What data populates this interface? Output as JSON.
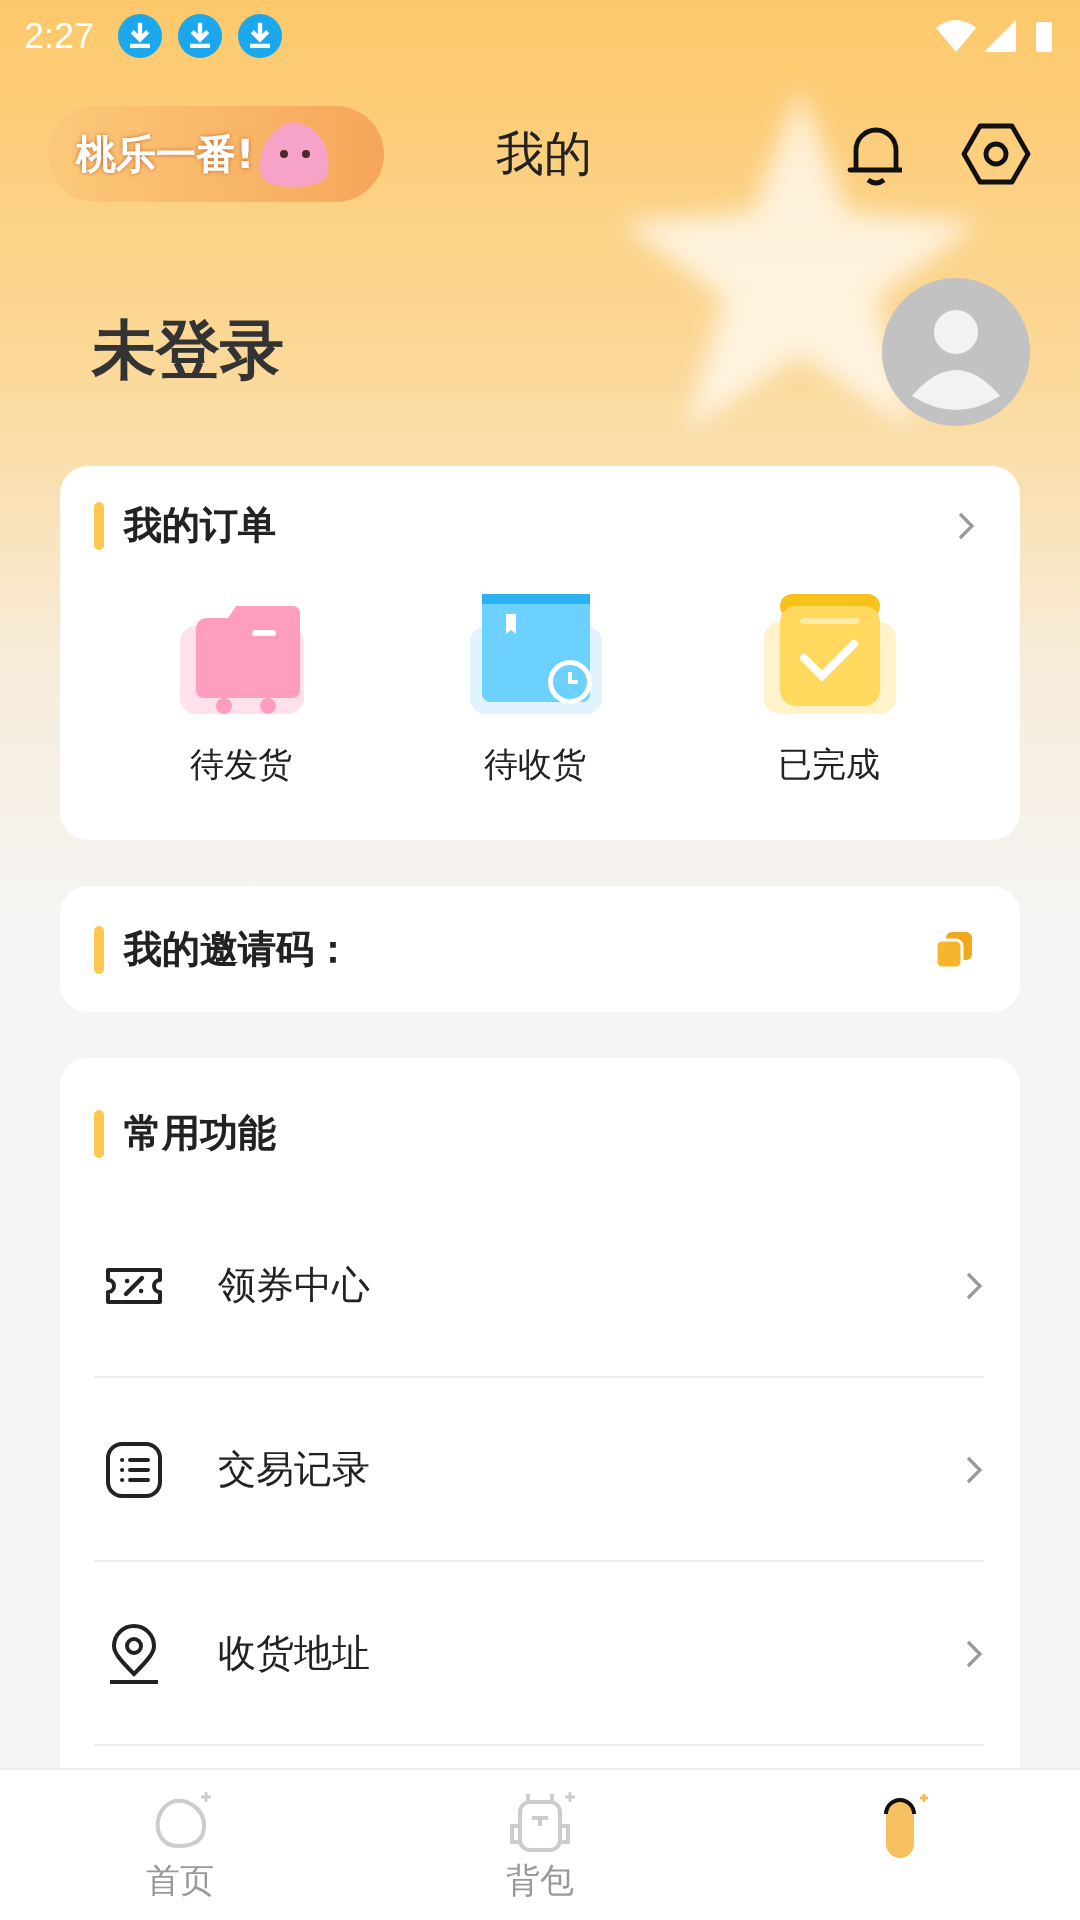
{
  "status_bar": {
    "time": "2:27",
    "notifications": [
      {
        "kind": "download"
      },
      {
        "kind": "download"
      },
      {
        "kind": "download"
      }
    ]
  },
  "header": {
    "logo": "桃乐一番!",
    "title": "我的"
  },
  "profile": {
    "name": "未登录"
  },
  "orders": {
    "title": "我的订单",
    "items": [
      {
        "kind": "ship",
        "label": "待发货"
      },
      {
        "kind": "receive",
        "label": "待收货"
      },
      {
        "kind": "done",
        "label": "已完成"
      }
    ]
  },
  "invite": {
    "label": "我的邀请码："
  },
  "functions": {
    "title": "常用功能",
    "items": [
      {
        "kind": "coupon",
        "label": "领券中心"
      },
      {
        "kind": "list",
        "label": "交易记录"
      },
      {
        "kind": "location",
        "label": "收货地址"
      }
    ]
  },
  "tabs": [
    {
      "kind": "home",
      "label": "首页",
      "selected": false
    },
    {
      "kind": "bag",
      "label": "背包",
      "selected": false
    },
    {
      "kind": "me",
      "selected": true
    }
  ]
}
